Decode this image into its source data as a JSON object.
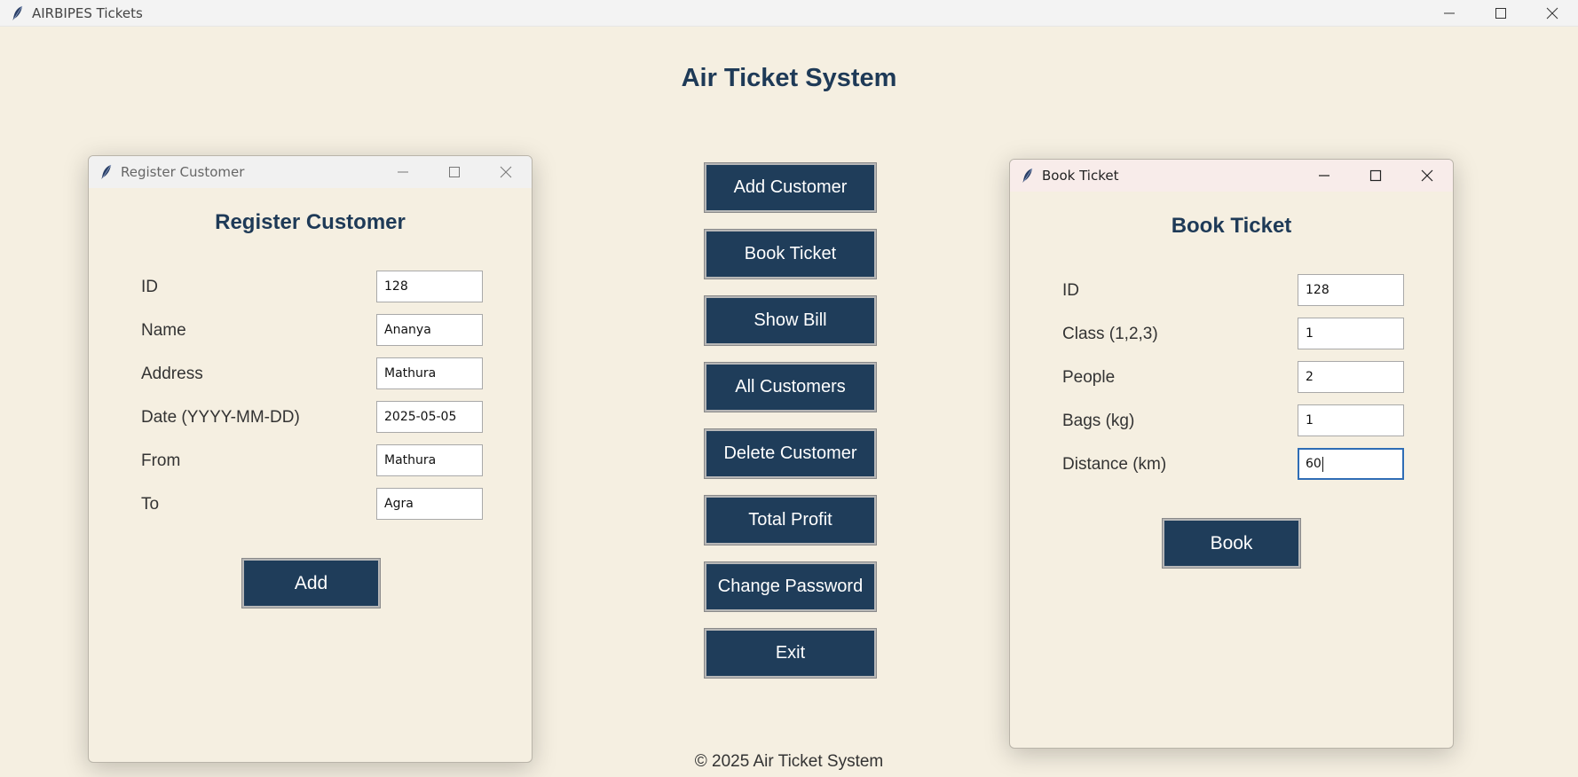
{
  "app": {
    "window_title": "AIRBIPES Tickets",
    "heading": "Air Ticket System",
    "footer": "© 2025 Air Ticket System"
  },
  "menu": [
    {
      "label": "Add Customer"
    },
    {
      "label": "Book Ticket"
    },
    {
      "label": "Show Bill"
    },
    {
      "label": "All Customers"
    },
    {
      "label": "Delete Customer"
    },
    {
      "label": "Total Profit"
    },
    {
      "label": "Change Password"
    },
    {
      "label": "Exit"
    }
  ],
  "register_dialog": {
    "window_title": "Register Customer",
    "heading": "Register Customer",
    "fields": [
      {
        "label": "ID",
        "value": "128"
      },
      {
        "label": "Name",
        "value": "Ananya"
      },
      {
        "label": "Address",
        "value": "Mathura"
      },
      {
        "label": "Date (YYYY-MM-DD)",
        "value": "2025-05-05"
      },
      {
        "label": "From",
        "value": "Mathura"
      },
      {
        "label": "To",
        "value": "Agra"
      }
    ],
    "submit_label": "Add"
  },
  "book_dialog": {
    "window_title": "Book Ticket",
    "heading": "Book Ticket",
    "fields": [
      {
        "label": "ID",
        "value": "128"
      },
      {
        "label": "Class (1,2,3)",
        "value": "1"
      },
      {
        "label": "People",
        "value": "2"
      },
      {
        "label": "Bags (kg)",
        "value": "1"
      },
      {
        "label": "Distance (km)",
        "value": "60"
      }
    ],
    "submit_label": "Book"
  },
  "colors": {
    "background": "#f5efe1",
    "button": "#1f3d5a",
    "heading": "#1e3a57",
    "focus": "#2f6db5"
  },
  "icons": {
    "app": "feather-icon",
    "minimize": "minimize-icon",
    "maximize": "maximize-icon",
    "close": "close-icon"
  }
}
